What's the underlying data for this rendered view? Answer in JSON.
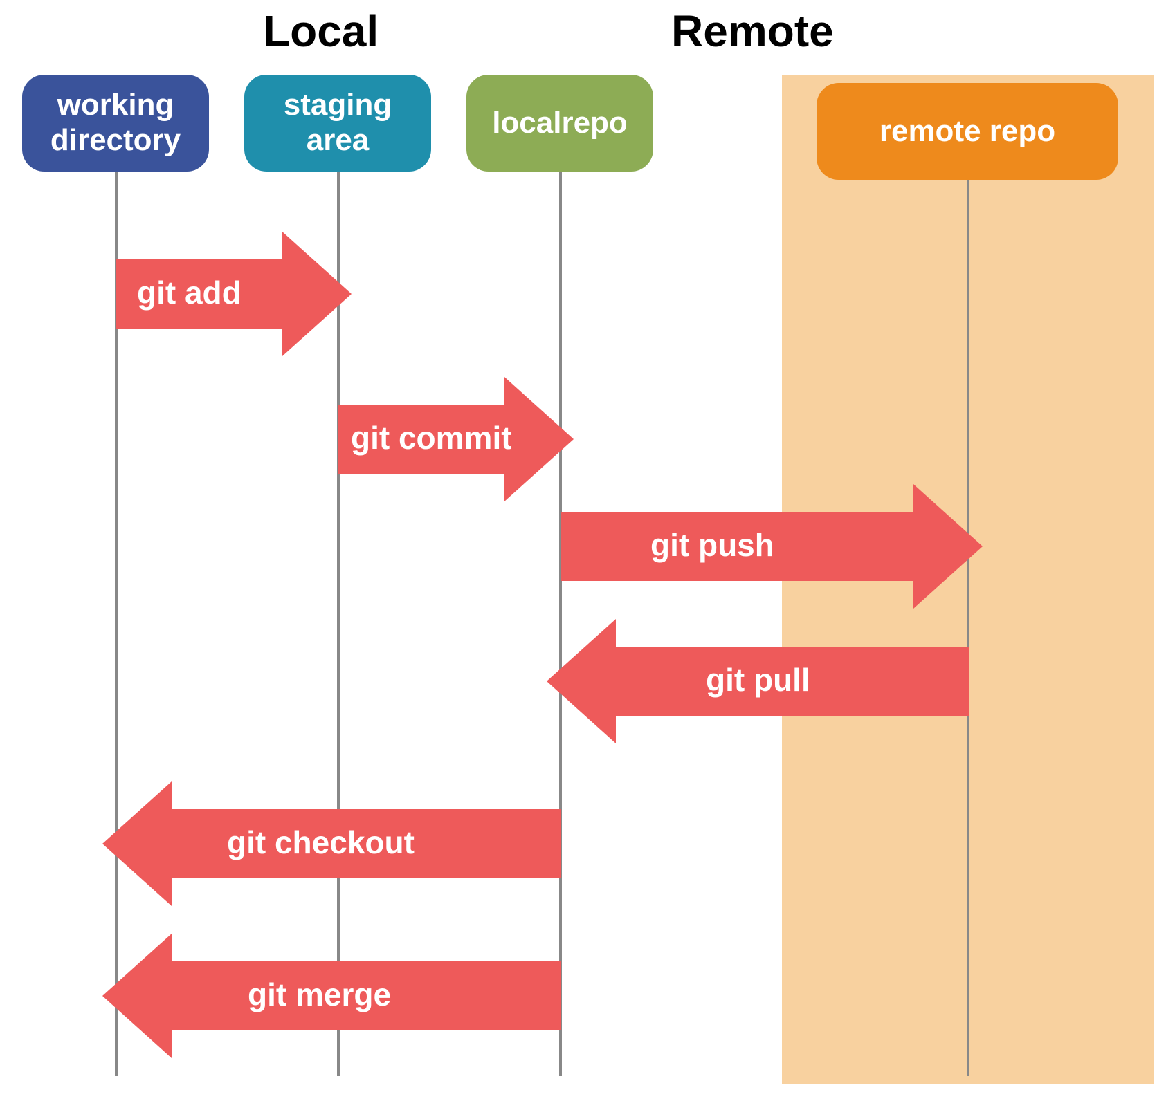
{
  "sections": {
    "local": "Local",
    "remote": "Remote"
  },
  "lanes": {
    "working_directory": "working directory",
    "staging_area": "staging area",
    "local_repo": "localrepo",
    "remote_repo": "remote repo"
  },
  "commands": {
    "git_add": "git add",
    "git_commit": "git commit",
    "git_push": "git push",
    "git_pull": "git pull",
    "git_checkout": "git checkout",
    "git_merge": "git merge"
  },
  "colors": {
    "working_directory": "#3a539b",
    "staging_area": "#1f8fac",
    "local_repo": "#8dac55",
    "remote_repo": "#ee8a1c",
    "arrow": "#ee5a5a",
    "remote_bg": "#f8d19f"
  }
}
